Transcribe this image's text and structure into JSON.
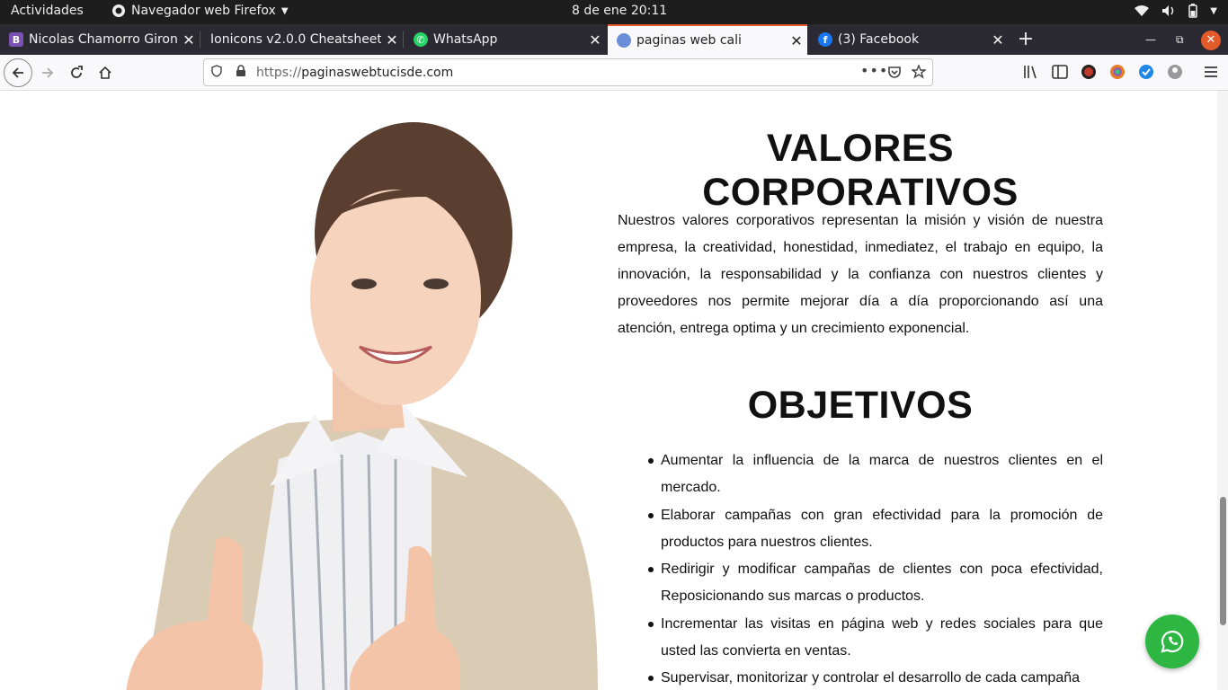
{
  "system_bar": {
    "activities": "Actividades",
    "app_name": "Navegador web Firefox",
    "clock": "8 de ene  20:11"
  },
  "tabs": [
    {
      "title": "Nicolas Chamorro Giron",
      "favicon": "B",
      "favicon_color": "#7952b3"
    },
    {
      "title": "Ionicons v2.0.0 Cheatsheet",
      "favicon": "",
      "favicon_color": ""
    },
    {
      "title": "WhatsApp",
      "favicon": "whatsapp-icon",
      "favicon_color": "#25d366"
    },
    {
      "title": "paginas web cali",
      "favicon": "globe-icon",
      "favicon_color": "#e35b2a",
      "active": true
    },
    {
      "title": "(3) Facebook",
      "favicon": "f",
      "favicon_color": "#1877f2"
    }
  ],
  "url": {
    "protocol": "https://",
    "host": "paginaswebtucisde.com"
  },
  "content": {
    "valores_heading": "VALORES CORPORATIVOS",
    "valores_text": "Nuestros valores corporativos representan la misión y visión de nuestra empresa, la creatividad, honestidad, inmediatez, el trabajo en equipo, la innovación, la responsabilidad y la confianza con nuestros clientes y proveedores nos permite mejorar día a día proporcionando así una atención, entrega optima y un crecimiento exponencial.",
    "objetivos_heading": "OBJETIVOS",
    "objetivos": [
      "Aumentar la influencia de la marca de nuestros clientes en el mercado.",
      "Elaborar campañas con gran efectividad para la promoción de productos para nuestros clientes.",
      "Redirigir y modificar campañas de clientes con poca efectividad, Reposicionando sus marcas o productos.",
      "Incrementar las visitas en página web y redes sociales para que usted las convierta en ventas.",
      "Supervisar, monitorizar y controlar el desarrollo de cada campaña"
    ]
  },
  "colors": {
    "accent": "#e35b2a",
    "whatsapp": "#2db742"
  }
}
